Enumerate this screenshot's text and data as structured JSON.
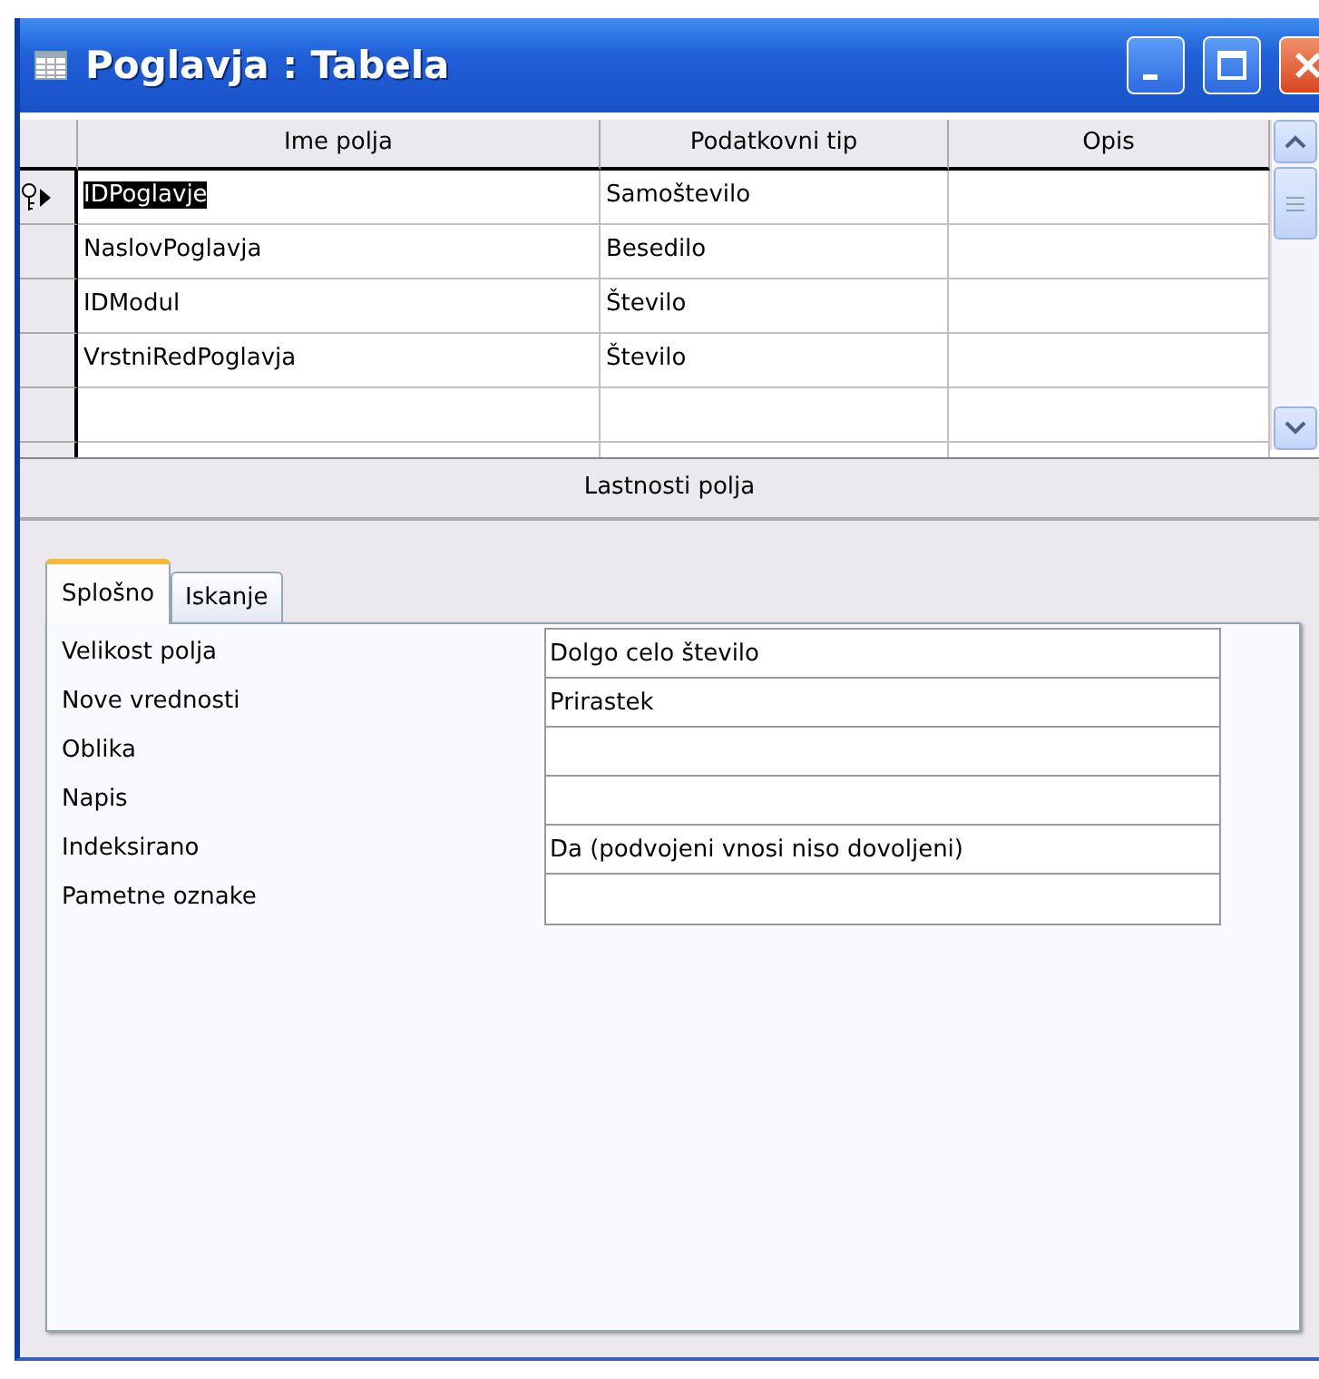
{
  "window": {
    "title": "Poglavja : Tabela"
  },
  "table": {
    "columns": [
      "Ime polja",
      "Podatkovni tip",
      "Opis"
    ],
    "rows": [
      {
        "name": "IDPoglavje",
        "type": "Samoštevilo",
        "selected": true,
        "primary_key": true
      },
      {
        "name": "NaslovPoglavja",
        "type": "Besedilo",
        "selected": false,
        "primary_key": false
      },
      {
        "name": "IDModul",
        "type": "Število",
        "selected": false,
        "primary_key": false
      },
      {
        "name": "VrstniRedPoglavja",
        "type": "Število",
        "selected": false,
        "primary_key": false
      }
    ]
  },
  "properties": {
    "title": "Lastnosti polja",
    "tabs": [
      {
        "label": "Splošno",
        "selected": true
      },
      {
        "label": "Iskanje",
        "selected": false
      }
    ],
    "rows": [
      {
        "label": "Velikost polja",
        "value": "Dolgo celo število"
      },
      {
        "label": "Nove vrednosti",
        "value": "Prirastek"
      },
      {
        "label": "Oblika"
      },
      {
        "label": "Napis"
      },
      {
        "label": "Indeksirano",
        "value": "Da (podvojeni vnosi niso dovoljeni)"
      },
      {
        "label": "Pametne oznake"
      }
    ]
  }
}
